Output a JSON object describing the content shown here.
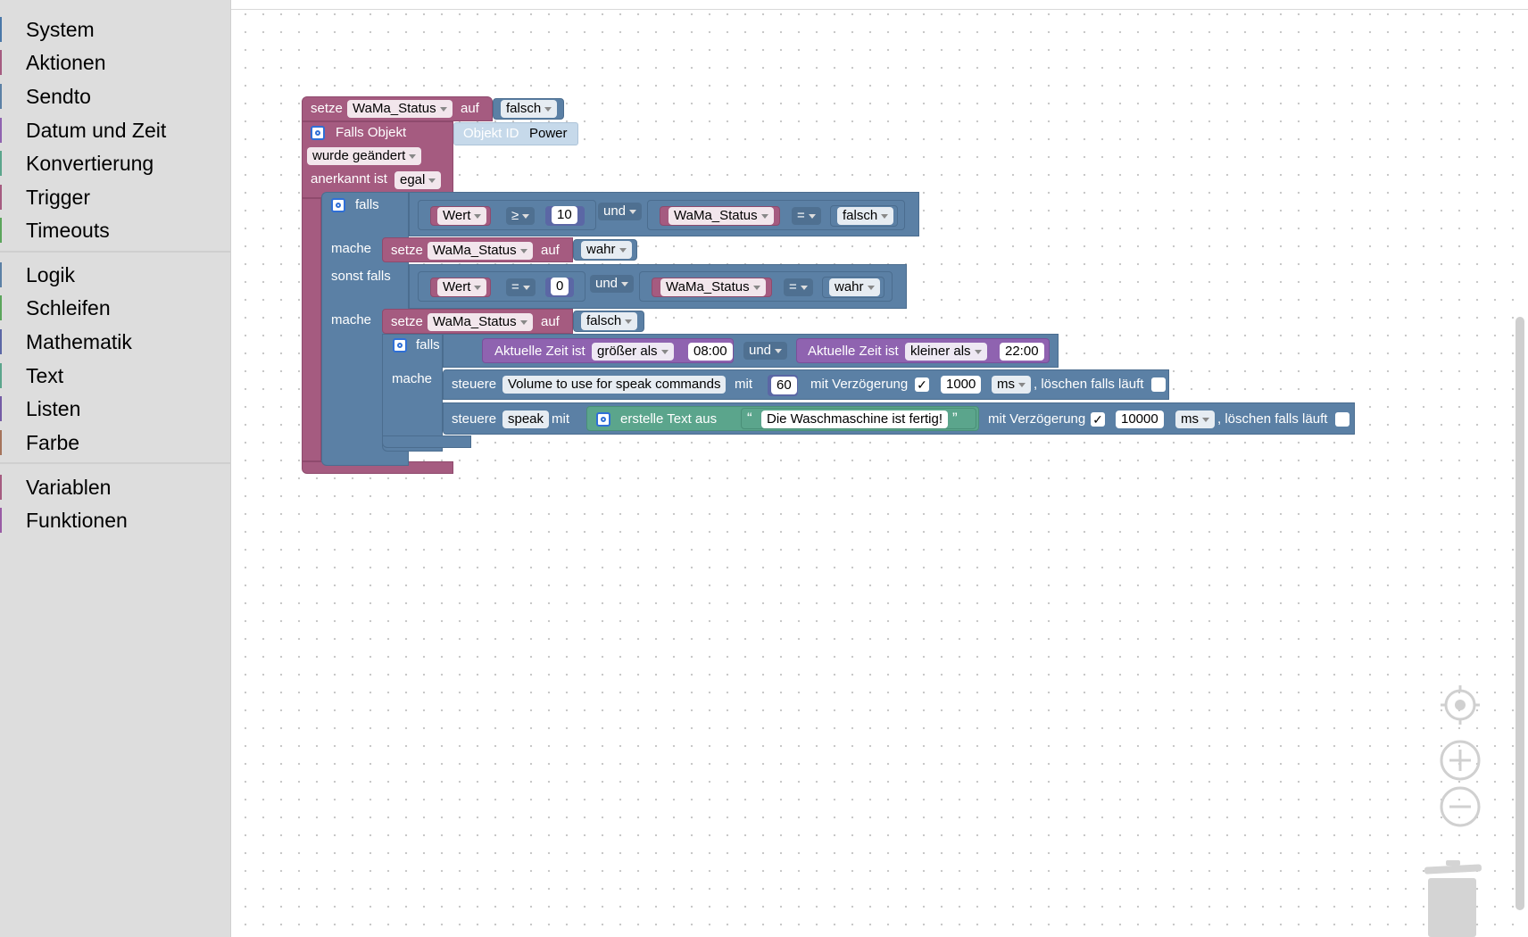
{
  "toolbox": {
    "categories": [
      {
        "label": "System",
        "color": "#4a77a8"
      },
      {
        "label": "Aktionen",
        "color": "#a55b80"
      },
      {
        "label": "Sendto",
        "color": "#5b80a5"
      },
      {
        "label": "Datum und Zeit",
        "color": "#8f63b0"
      },
      {
        "label": "Konvertierung",
        "color": "#5ba58c"
      },
      {
        "label": "Trigger",
        "color": "#a55b80"
      },
      {
        "label": "Timeouts",
        "color": "#5ba55b"
      },
      {
        "label": "Logik",
        "color": "#5b80a5"
      },
      {
        "label": "Schleifen",
        "color": "#5ba55b"
      },
      {
        "label": "Mathematik",
        "color": "#5b67a5"
      },
      {
        "label": "Text",
        "color": "#5ba58c"
      },
      {
        "label": "Listen",
        "color": "#745ba5"
      },
      {
        "label": "Farbe",
        "color": "#a5745b"
      },
      {
        "label": "Variablen",
        "color": "#a55b80"
      },
      {
        "label": "Funktionen",
        "color": "#995ba5"
      }
    ]
  },
  "blocks": {
    "setze": "setze",
    "auf": "auf",
    "var_wama": "WaMa_Status",
    "falsch": "falsch",
    "wahr": "wahr",
    "falls_objekt": "Falls Objekt",
    "objekt_id": "Objekt ID",
    "power": "Power",
    "wurde_geaendert": "wurde geändert",
    "anerkannt_ist": "anerkannt ist",
    "egal": "egal",
    "falls": "falls",
    "mache": "mache",
    "sonst_falls": "sonst falls",
    "wert": "Wert",
    "op_ge": "≥",
    "op_eq": "=",
    "num_10": "10",
    "num_0": "0",
    "und": "und",
    "aktuelle_zeit_ist": "Aktuelle Zeit ist",
    "groesser_als": "größer als",
    "kleiner_als": "kleiner als",
    "time_0800": "08:00",
    "time_2200": "22:00",
    "steuere": "steuere",
    "volume_obj": "Volume to use for speak commands",
    "mit": "mit",
    "num_60": "60",
    "mit_verzoegerung": "mit Verzögerung",
    "check_mark": "✓",
    "delay_1000": "1000",
    "ms": "ms",
    "loeschen": ", löschen falls läuft",
    "speak_obj": "speak",
    "erstelle_text_aus": "erstelle Text aus",
    "quote_open": "“",
    "quote_close": "”",
    "text_fertig": "Die Waschmaschine ist fertig!",
    "delay_10000": "10000"
  },
  "colors": {
    "variables": "#a55b80",
    "logic": "#5b80a5",
    "time": "#8f63b0",
    "text": "#5ba58c"
  },
  "controls": [
    "recenter-icon",
    "zoom-in-icon",
    "zoom-out-icon",
    "trash-icon"
  ]
}
